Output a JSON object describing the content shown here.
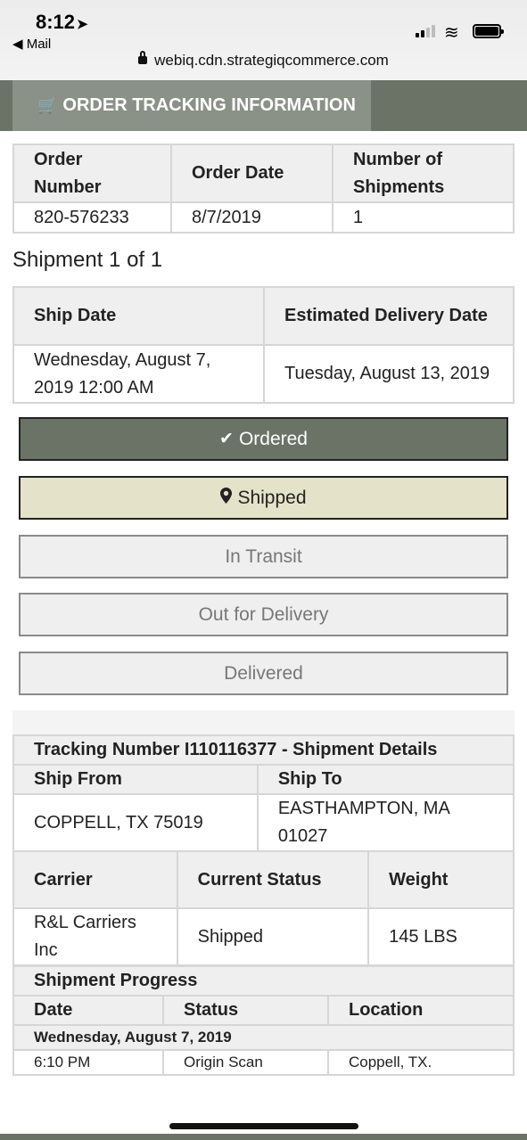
{
  "status_bar": {
    "time": "8:12",
    "location_icon": "location-arrow-icon",
    "back_app": "◀ Mail",
    "url": "webiq.cdn.strategiqcommerce.com"
  },
  "header": {
    "title": "ORDER TRACKING INFORMATION",
    "icon": "cart-icon"
  },
  "order": {
    "headers": [
      "Order Number",
      "Order Date",
      "Number of Shipments"
    ],
    "values": [
      "820-576233",
      "8/7/2019",
      "1"
    ]
  },
  "shipment": {
    "heading": "Shipment 1 of 1",
    "headers": [
      "Ship Date",
      "Estimated Delivery Date"
    ],
    "values": [
      "Wednesday, August 7, 2019 12:00 AM",
      "Tuesday, August 13, 2019"
    ]
  },
  "steps": [
    {
      "label": "Ordered",
      "state": "done",
      "icon": "check-icon"
    },
    {
      "label": "Shipped",
      "state": "current",
      "icon": "map-marker-icon"
    },
    {
      "label": "In Transit",
      "state": "pending"
    },
    {
      "label": "Out for Delivery",
      "state": "pending"
    },
    {
      "label": "Delivered",
      "state": "pending"
    }
  ],
  "details": {
    "caption": "Tracking Number I110116377 - Shipment Details",
    "ship_from_label": "Ship From",
    "ship_to_label": "Ship To",
    "ship_from": "COPPELL, TX 75019",
    "ship_to": "EASTHAMPTON, MA 01027",
    "carrier_label": "Carrier",
    "status_label": "Current Status",
    "weight_label": "Weight",
    "carrier": "R&L Carriers Inc",
    "status": "Shipped",
    "weight": "145 LBS"
  },
  "progress": {
    "caption": "Shipment Progress",
    "headers": [
      "Date",
      "Status",
      "Location"
    ],
    "groups": [
      {
        "date": "Wednesday, August 7, 2019",
        "rows": [
          {
            "time": "6:10 PM",
            "status": "Origin Scan",
            "location": "Coppell, TX."
          }
        ]
      }
    ]
  },
  "colors": {
    "header_bg": "#6b7367",
    "header_tab": "#8a9186",
    "step_done": "#6b7367",
    "step_current": "#e4e3c9",
    "step_pending": "#efefef"
  }
}
